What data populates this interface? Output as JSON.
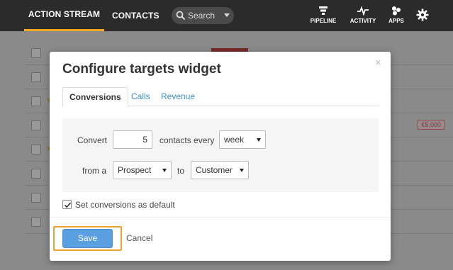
{
  "topnav": {
    "tabs": [
      {
        "label": "ACTION STREAM"
      },
      {
        "label": "CONTACTS"
      }
    ],
    "search_placeholder": "Search",
    "icons": [
      {
        "name": "pipeline-icon",
        "label": "PIPELINE"
      },
      {
        "name": "activity-icon",
        "label": "ACTIVITY"
      },
      {
        "name": "apps-icon",
        "label": "APPS"
      },
      {
        "name": "gear-icon",
        "label": ""
      }
    ]
  },
  "background": {
    "badge_amount": "€5,000"
  },
  "modal": {
    "title": "Configure targets widget",
    "close_symbol": "×",
    "tabs": [
      {
        "label": "Conversions",
        "active": true
      },
      {
        "label": "Calls",
        "active": false
      },
      {
        "label": "Revenue",
        "active": false
      }
    ],
    "form": {
      "convert_label": "Convert",
      "count_value": "5",
      "contacts_every_label": "contacts every",
      "period_value": "week",
      "from_label": "from a",
      "from_stage_value": "Prospect",
      "to_label": "to",
      "to_stage_value": "Customer"
    },
    "default_checkbox": {
      "checked": true,
      "label": "Set conversions as default"
    },
    "save_label": "Save",
    "cancel_label": "Cancel",
    "highlight_color": "#f0a030"
  }
}
